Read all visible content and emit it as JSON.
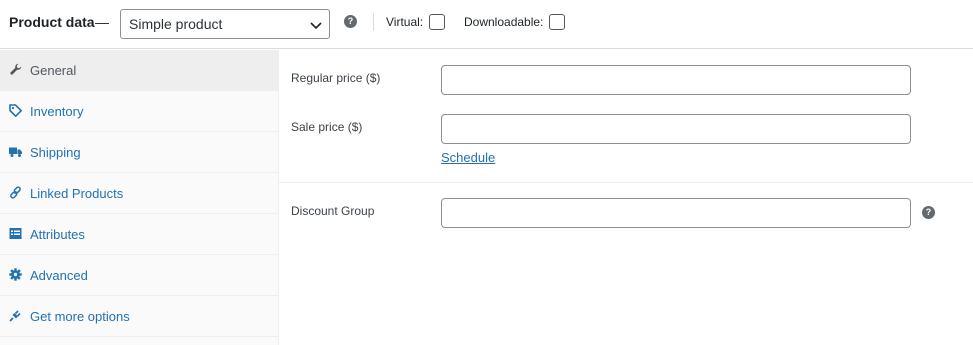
{
  "header": {
    "title": "Product data",
    "dash": "—",
    "product_type": {
      "selected": "Simple product"
    },
    "virtual_label": "Virtual:",
    "downloadable_label": "Downloadable:",
    "help_glyph": "?"
  },
  "sidebar": {
    "items": [
      {
        "label": "General",
        "icon": "wrench-icon",
        "active": true
      },
      {
        "label": "Inventory",
        "icon": "tag-icon"
      },
      {
        "label": "Shipping",
        "icon": "truck-icon"
      },
      {
        "label": "Linked Products",
        "icon": "link-icon"
      },
      {
        "label": "Attributes",
        "icon": "list-view-icon"
      },
      {
        "label": "Advanced",
        "icon": "gear-icon"
      },
      {
        "label": "Get more options",
        "icon": "plugin-icon"
      }
    ]
  },
  "main": {
    "regular_price": {
      "label": "Regular price ($)",
      "value": ""
    },
    "sale_price": {
      "label": "Sale price ($)",
      "value": ""
    },
    "schedule_link": "Schedule",
    "discount_group": {
      "label": "Discount Group",
      "value": ""
    },
    "help_glyph": "?"
  },
  "colors": {
    "link": "#2271b1",
    "text": "#3c434a",
    "border": "#8c8f94",
    "active_tab_bg": "#eeeeee",
    "sidebar_bg": "#fafafa"
  }
}
